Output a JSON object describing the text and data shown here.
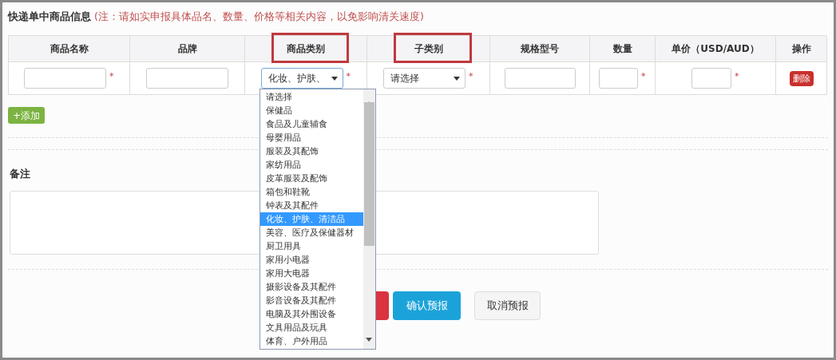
{
  "title": "快递单中商品信息",
  "note": "(注：请如实申报具体品名、数量、价格等相关内容，以免影响清关速度)",
  "columns": [
    {
      "label": "商品名称",
      "highlighted": false
    },
    {
      "label": "品牌",
      "highlighted": false
    },
    {
      "label": "商品类别",
      "highlighted": true
    },
    {
      "label": "子类别",
      "highlighted": true
    },
    {
      "label": "规格型号",
      "highlighted": false
    },
    {
      "label": "数量",
      "highlighted": false
    },
    {
      "label": "单价（USD/AUD）",
      "highlighted": false
    },
    {
      "label": "操作",
      "highlighted": false
    }
  ],
  "row": [
    {
      "kind": "input",
      "mark": "*"
    },
    {
      "kind": "input"
    },
    {
      "kind": "select",
      "value": "化妆、护肤、",
      "mark": "*",
      "expanded": true
    },
    {
      "kind": "select",
      "value": "请选择",
      "mark": "*",
      "expanded": false
    },
    {
      "kind": "input"
    },
    {
      "kind": "input",
      "mark": "*"
    },
    {
      "kind": "input",
      "mark": "*"
    },
    {
      "kind": "button",
      "label": "删除"
    }
  ],
  "add_button": "+添加",
  "dropdown": [
    {
      "label": "请选择",
      "selected": false
    },
    {
      "label": "保健品",
      "selected": false
    },
    {
      "label": "食品及儿童辅食",
      "selected": false
    },
    {
      "label": "母婴用品",
      "selected": false
    },
    {
      "label": "服装及其配饰",
      "selected": false
    },
    {
      "label": "家纺用品",
      "selected": false
    },
    {
      "label": "皮革服装及配饰",
      "selected": false
    },
    {
      "label": "箱包和鞋靴",
      "selected": false
    },
    {
      "label": "钟表及其配件",
      "selected": false
    },
    {
      "label": "化妆、护肤、清洁品",
      "selected": true
    },
    {
      "label": "美容、医疗及保健器材",
      "selected": false
    },
    {
      "label": "厨卫用具",
      "selected": false
    },
    {
      "label": "家用小电器",
      "selected": false
    },
    {
      "label": "家用大电器",
      "selected": false
    },
    {
      "label": "摄影设备及其配件",
      "selected": false
    },
    {
      "label": "影音设备及其配件",
      "selected": false
    },
    {
      "label": "电脑及其外围设备",
      "selected": false
    },
    {
      "label": "文具用品及玩具",
      "selected": false
    },
    {
      "label": "体育、户外用品",
      "selected": false
    }
  ],
  "remarks_label": "备注",
  "actions": [
    {
      "kind": "danger"
    },
    {
      "kind": "primary",
      "label": "确认预报"
    },
    {
      "kind": "default",
      "label": "取消预报"
    }
  ]
}
